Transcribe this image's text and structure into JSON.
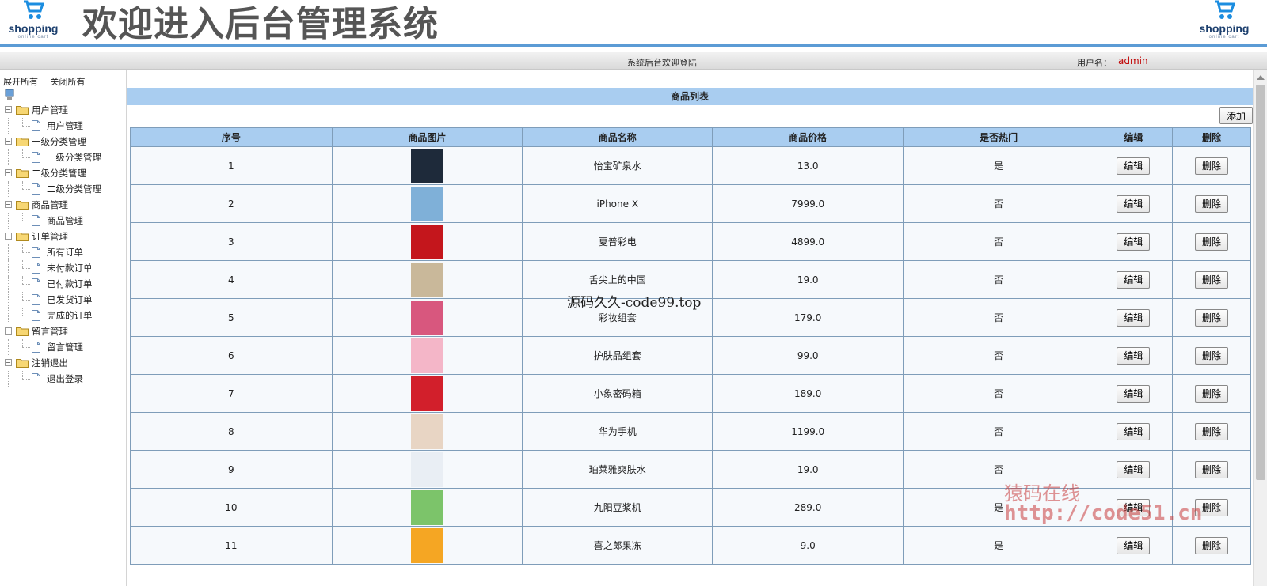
{
  "header": {
    "system_title": "欢迎进入后台管理系统",
    "logo_brand": "shopping",
    "logo_tagline": "online cart"
  },
  "welcome_bar": {
    "text": "系统后台欢迎登陆",
    "user_label": "用户名：",
    "user_name": "admin"
  },
  "sidebar": {
    "expand_all": "展开所有",
    "collapse_all": "关闭所有",
    "groups": [
      {
        "label": "用户管理",
        "items": [
          "用户管理"
        ]
      },
      {
        "label": "一级分类管理",
        "items": [
          "一级分类管理"
        ]
      },
      {
        "label": "二级分类管理",
        "items": [
          "二级分类管理"
        ]
      },
      {
        "label": "商品管理",
        "items": [
          "商品管理"
        ]
      },
      {
        "label": "订单管理",
        "items": [
          "所有订单",
          "未付款订单",
          "已付款订单",
          "已发货订单",
          "完成的订单"
        ]
      },
      {
        "label": "留言管理",
        "items": [
          "留言管理"
        ]
      },
      {
        "label": "注销退出",
        "items": [
          "退出登录"
        ]
      }
    ]
  },
  "main": {
    "list_title": "商品列表",
    "add_label": "添加",
    "columns": [
      "序号",
      "商品图片",
      "商品名称",
      "商品价格",
      "是否热门",
      "编辑",
      "删除"
    ],
    "edit_label": "编辑",
    "delete_label": "删除",
    "rows": [
      {
        "no": "1",
        "name": "怡宝矿泉水",
        "price": "13.0",
        "hot": "是",
        "thumb_color": "#1e2a3a"
      },
      {
        "no": "2",
        "name": "iPhone X",
        "price": "7999.0",
        "hot": "否",
        "thumb_color": "#7fb0d8"
      },
      {
        "no": "3",
        "name": "夏普彩电",
        "price": "4899.0",
        "hot": "否",
        "thumb_color": "#c4161c"
      },
      {
        "no": "4",
        "name": "舌尖上的中国",
        "price": "19.0",
        "hot": "否",
        "thumb_color": "#c9b89a"
      },
      {
        "no": "5",
        "name": "彩妆组套",
        "price": "179.0",
        "hot": "否",
        "thumb_color": "#d8577e"
      },
      {
        "no": "6",
        "name": "护肤品组套",
        "price": "99.0",
        "hot": "否",
        "thumb_color": "#f4b6c8"
      },
      {
        "no": "7",
        "name": "小象密码箱",
        "price": "189.0",
        "hot": "否",
        "thumb_color": "#d21f2b"
      },
      {
        "no": "8",
        "name": "华为手机",
        "price": "1199.0",
        "hot": "否",
        "thumb_color": "#e8d5c4"
      },
      {
        "no": "9",
        "name": "珀莱雅爽肤水",
        "price": "19.0",
        "hot": "否",
        "thumb_color": "#e9eef4"
      },
      {
        "no": "10",
        "name": "九阳豆浆机",
        "price": "289.0",
        "hot": "是",
        "thumb_color": "#7cc46a"
      },
      {
        "no": "11",
        "name": "喜之郎果冻",
        "price": "9.0",
        "hot": "是",
        "thumb_color": "#f5a623"
      }
    ]
  },
  "watermarks": {
    "center": "源码久久-code99.top",
    "corner_cn": "猿码在线",
    "corner_url": "http://code51.cn"
  }
}
